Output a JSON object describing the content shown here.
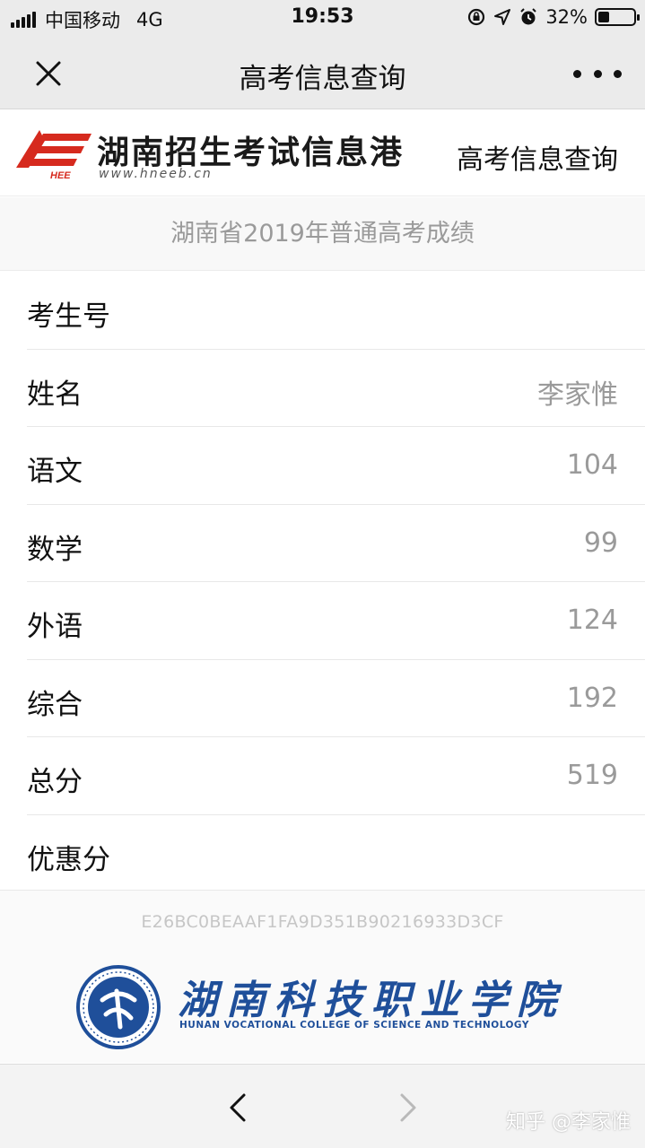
{
  "status_bar": {
    "carrier": "中国移动",
    "network": "4G",
    "time": "19:53",
    "battery_percent": "32%",
    "battery_level": 0.32,
    "icons": [
      "signal-icon",
      "rotation-lock-icon",
      "location-icon",
      "alarm-icon",
      "battery-icon"
    ]
  },
  "nav": {
    "title": "高考信息查询",
    "close_icon": "close-icon",
    "more_icon": "more-icon"
  },
  "site_header": {
    "logo_name": "湖南招生考试信息港",
    "logo_url": "www.hneeb.cn",
    "logo_mark_text": "HEE",
    "link": "高考信息查询"
  },
  "section_title": "湖南省2019年普通高考成绩",
  "rows": [
    {
      "label": "考生号",
      "value": ""
    },
    {
      "label": "姓名",
      "value": "李家惟"
    },
    {
      "label": "语文",
      "value": "104"
    },
    {
      "label": "数学",
      "value": "99"
    },
    {
      "label": "外语",
      "value": "124"
    },
    {
      "label": "综合",
      "value": "192"
    },
    {
      "label": "总分",
      "value": "519"
    },
    {
      "label": "优惠分",
      "value": ""
    }
  ],
  "hash_code": "E26BC0BEAAF1FA9D351B90216933D3CF",
  "college": {
    "name": "湖南科技职业学院",
    "name_en": "HUNAN VOCATIONAL COLLEGE OF SCIENCE AND TECHNOLOGY"
  },
  "bottom_bar": {
    "back_icon": "chevron-left-icon",
    "forward_icon": "chevron-right-icon"
  },
  "watermark": "知乎 @李家惟",
  "colors": {
    "bar_bg": "#ebebeb",
    "logo_red": "#d62a1e",
    "college_blue": "#1f4f9a",
    "muted_text": "#9a9a9a"
  }
}
